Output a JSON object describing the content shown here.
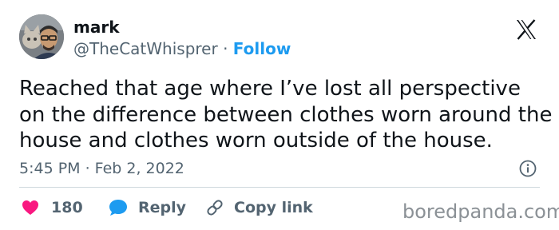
{
  "author": {
    "display_name": "mark",
    "handle": "@TheCatWhisprer",
    "separator": "·",
    "follow_label": "Follow"
  },
  "tweet": {
    "lines": [
      "Reached that age where I’ve lost all perspective",
      "on the difference between clothes worn around the",
      "house and clothes worn outside of the house."
    ],
    "timestamp": "5:45 PM · Feb 2, 2022"
  },
  "actions": {
    "like_count": "180",
    "reply_label": "Reply",
    "copy_link_label": "Copy link"
  },
  "watermark": "boredpanda.com",
  "icons": {
    "platform_logo": "x-logo-icon",
    "info": "info-icon",
    "like": "heart-icon",
    "reply": "speech-bubble-icon",
    "copy_link": "link-icon"
  },
  "colors": {
    "text": "#0f1419",
    "secondary_text": "#536471",
    "follow": "#1d9bf0",
    "heart": "#f91880",
    "reply_bubble": "#1d9bf0",
    "divider": "#cfd9de",
    "watermark": "#8b9196"
  }
}
